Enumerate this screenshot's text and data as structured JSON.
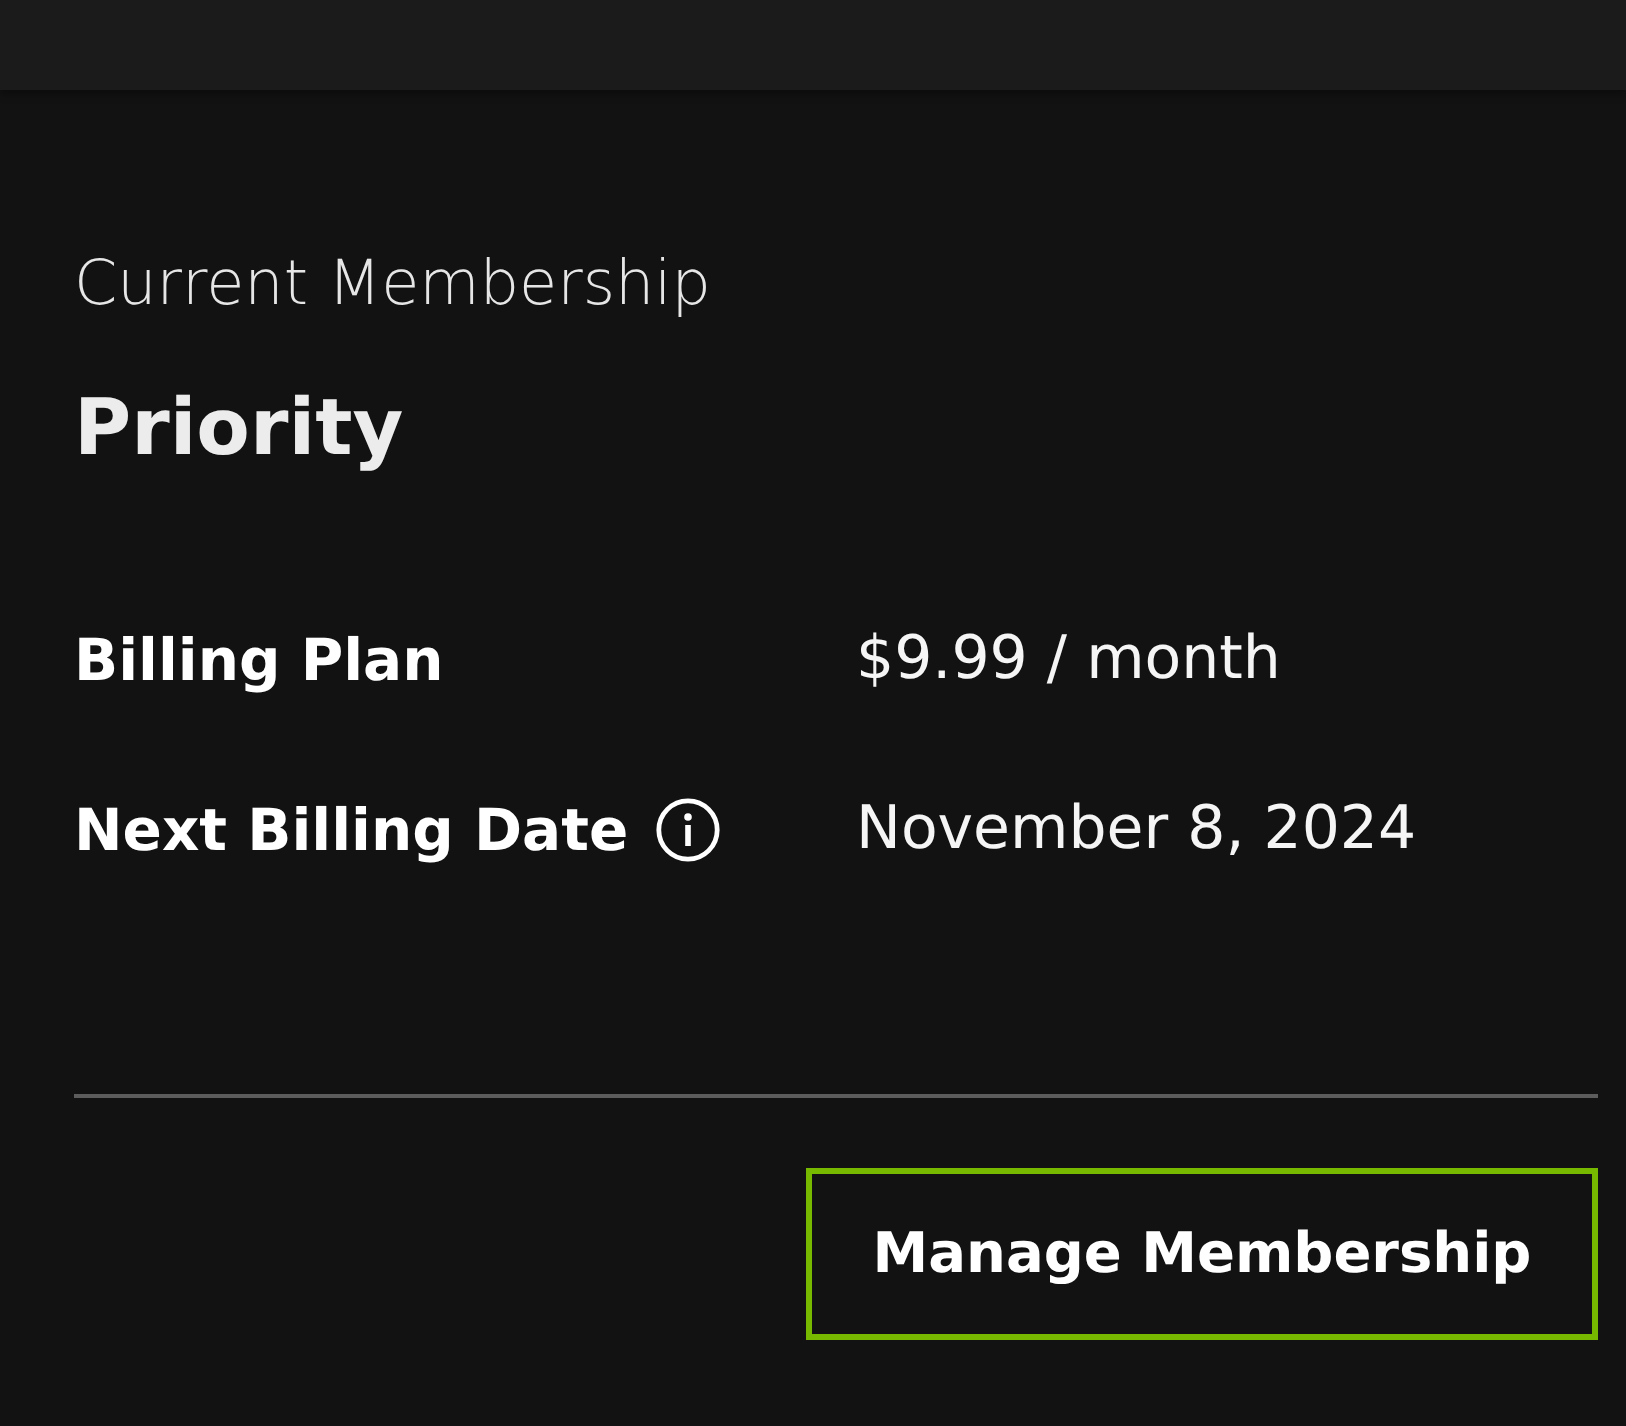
{
  "membership": {
    "heading": "Current Membership",
    "plan_name": "Priority"
  },
  "details": [
    {
      "label": "Billing Plan",
      "value": "$9.99 / month",
      "info": false
    },
    {
      "label": "Next Billing Date",
      "value": "November 8, 2024",
      "info": true
    }
  ],
  "buttons": [
    {
      "label": "Manage Membership"
    }
  ]
}
